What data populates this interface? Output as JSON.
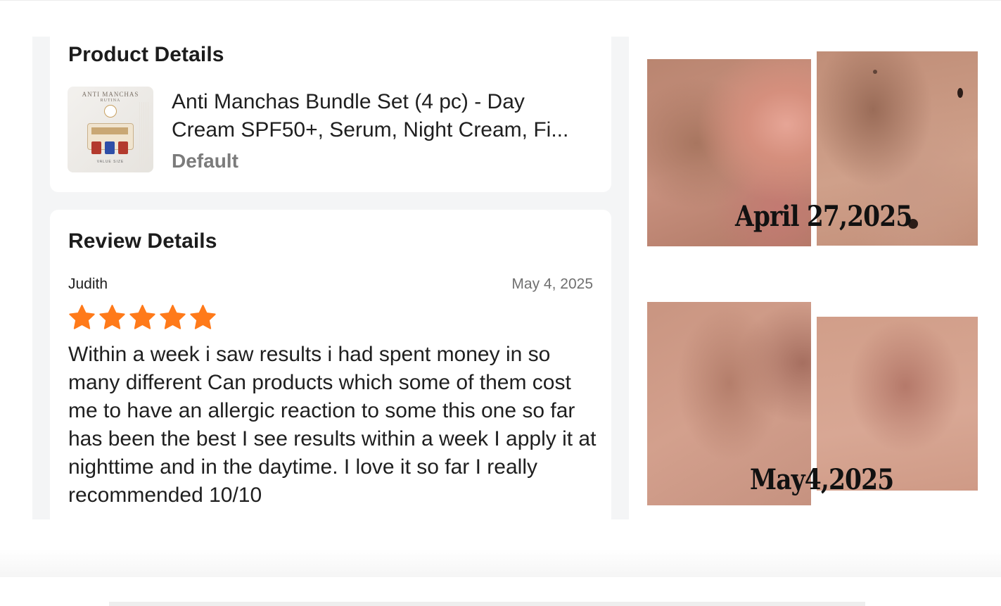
{
  "product_details": {
    "title": "Product Details",
    "thumbnail": {
      "brand": "ANTI MANCHAS",
      "sub": "RUTINA",
      "caption": "VALUE SIZE"
    },
    "name": "Anti Manchas Bundle Set (4 pc) - Day Cream SPF50+, Serum, Night Cream, Fi...",
    "variant": "Default"
  },
  "review_details": {
    "title": "Review Details",
    "reviewer": "Judith",
    "date": "May 4, 2025",
    "rating": 5,
    "text": "Within a week i saw results i had spent money in so many different Can products which some of them cost me to have an allergic reaction to some this one so far has been the best I see results within a week I apply it at nighttime and in the daytime. I love it so far I really recommended 10/10"
  },
  "photos": {
    "caption_before": "April 27,2025",
    "caption_after": "May4,2025"
  },
  "colors": {
    "star": "#ff7a1a",
    "panel_bg": "#f4f5f6"
  }
}
